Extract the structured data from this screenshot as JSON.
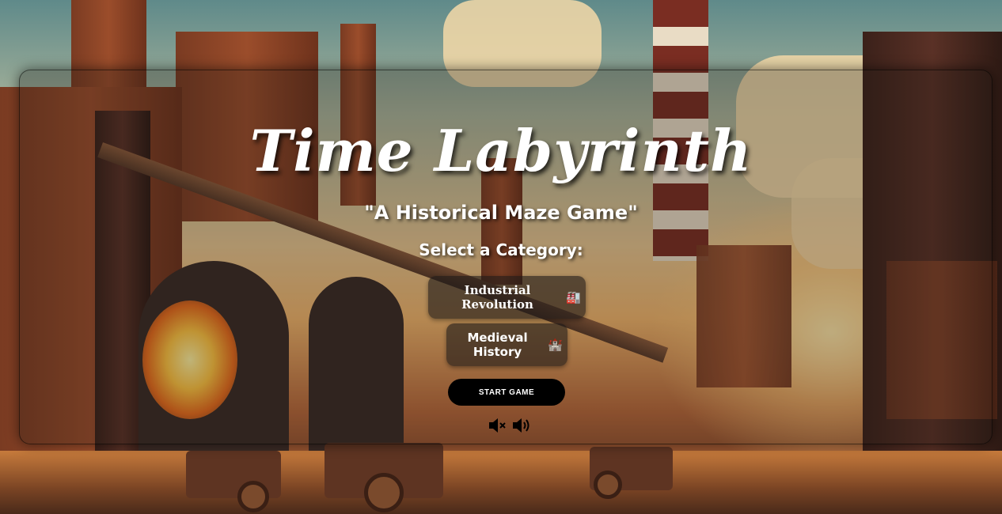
{
  "game": {
    "title": "Time Labyrinth",
    "subtitle": "\"A Historical Maze Game\"",
    "select_prompt": "Select a Category:"
  },
  "categories": [
    {
      "label": "Industrial Revolution",
      "emoji": "🏭"
    },
    {
      "label": "Medieval History",
      "emoji": "🏰"
    }
  ],
  "actions": {
    "start_label": "START GAME"
  },
  "sound": {
    "mute_icon": "speaker-mute-icon",
    "unmute_icon": "speaker-on-icon"
  }
}
